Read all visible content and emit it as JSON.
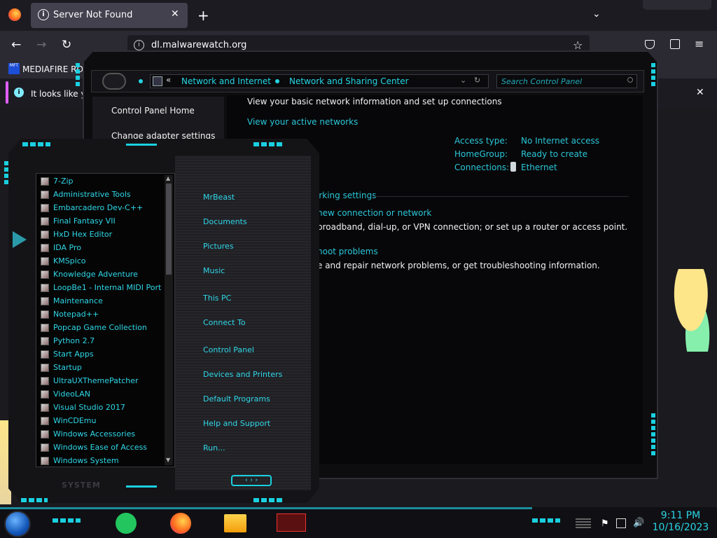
{
  "browser": {
    "tab_title": "Server Not Found",
    "url": "dl.malwarewatch.org",
    "bookmark": "MEDIAFIRE RO",
    "bookmark_icon_text": "MFT",
    "notification": "It looks like y"
  },
  "control_panel": {
    "breadcrumb": [
      "Network and Internet",
      "Network and Sharing Center"
    ],
    "search_placeholder": "Search Control Panel",
    "left_links": [
      "Control Panel Home",
      "Change adapter settings"
    ],
    "heading": "View your basic network information and set up connections",
    "active_networks": "View your active networks",
    "access_type_label": "Access type:",
    "access_type_value": "No Internet access",
    "homegroup_label": "HomeGroup:",
    "homegroup_value": "Ready to create",
    "connections_label": "Connections:",
    "connections_value": "Ethernet",
    "change_settings": "orking settings",
    "new_connection_link": "new connection or network",
    "new_connection_desc": "broadband, dial-up, or VPN connection; or set up a router or access point.",
    "troubleshoot_link": "hoot problems",
    "troubleshoot_desc": "e and repair network problems, or get troubleshooting information."
  },
  "start_menu": {
    "programs": [
      "7-Zip",
      "Administrative Tools",
      "Embarcadero Dev-C++",
      "Final Fantasy VII",
      "HxD Hex Editor",
      "IDA Pro",
      "KMSpico",
      "Knowledge Adventure",
      "LoopBe1 - Internal MIDI Port",
      "Maintenance",
      "Notepad++",
      "Popcap Game Collection",
      "Python 2.7",
      "Start Apps",
      "Startup",
      "UltraUXThemePatcher",
      "VideoLAN",
      "Visual Studio 2017",
      "WinCDEmu",
      "Windows Accessories",
      "Windows Ease of Access",
      "Windows System"
    ],
    "places": [
      "MrBeast",
      "Documents",
      "Pictures",
      "Music",
      "This PC",
      "Connect To",
      "Control Panel",
      "Devices and Printers",
      "Default Programs",
      "Help and Support",
      "Run..."
    ],
    "footer": "SYSTEM"
  },
  "taskbar": {
    "time": "9:11 PM",
    "date": "10/16/2023"
  },
  "colors": {
    "accent": "#25d5e4",
    "browser_bg": "#1c1b22",
    "toolbar": "#2b2a33"
  }
}
